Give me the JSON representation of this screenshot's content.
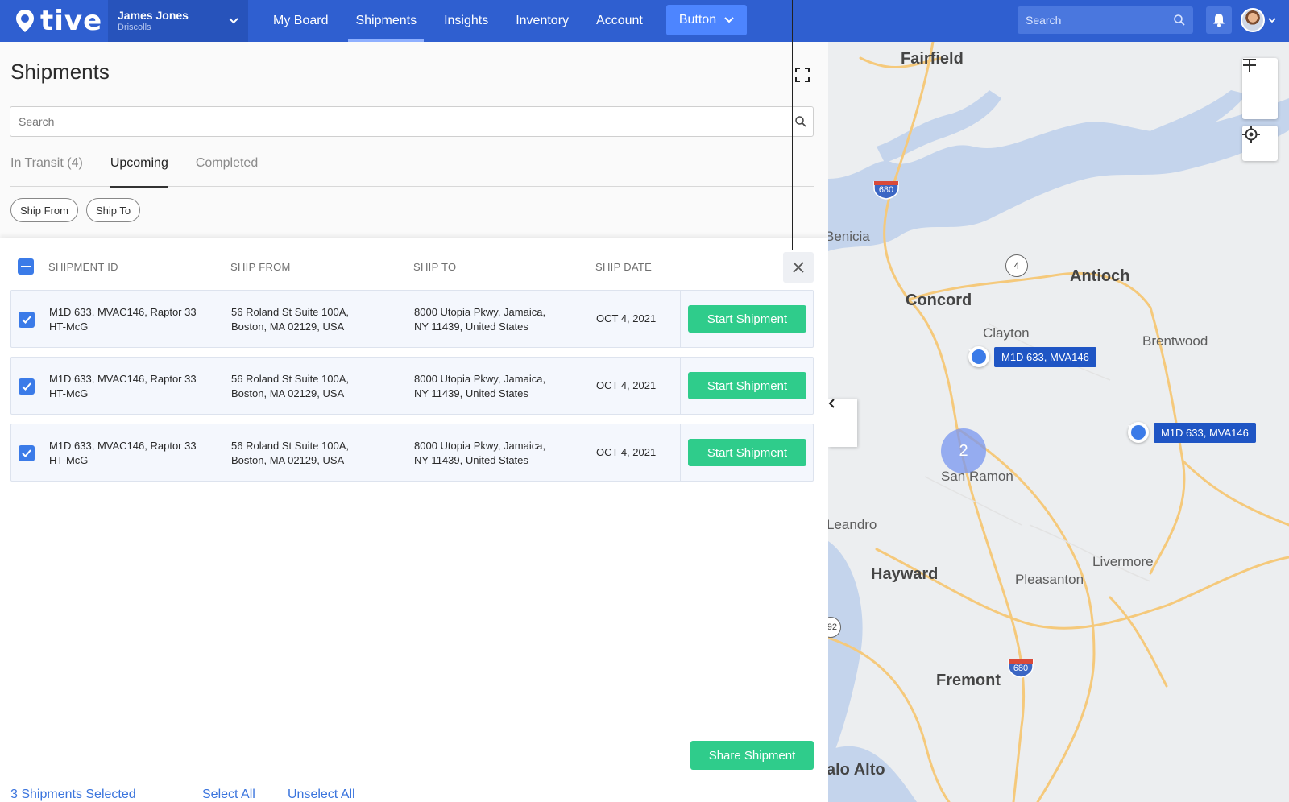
{
  "header": {
    "logo_text": "tive",
    "account_name": "James Jones",
    "account_org": "Driscolls",
    "nav": [
      "My Board",
      "Shipments",
      "Insights",
      "Inventory",
      "Account"
    ],
    "active_nav": "Shipments",
    "button_label": "Button",
    "search_placeholder": "Search"
  },
  "panel": {
    "title": "Shipments",
    "search_placeholder": "Search",
    "tabs": [
      "In Transit (4)",
      "Upcoming",
      "Completed"
    ],
    "active_tab": "Upcoming",
    "chips": [
      "Ship From",
      "Ship To"
    ]
  },
  "table": {
    "columns": [
      "SHIPMENT ID",
      "SHIP FROM",
      "SHIP TO",
      "SHIP DATE"
    ],
    "rows": [
      {
        "id_line1": "M1D 633, MVAC146, Raptor 33",
        "id_line2": "HT-McG",
        "from_line1": "56 Roland St Suite 100A,",
        "from_line2": "Boston, MA 02129, USA",
        "to_line1": "8000 Utopia Pkwy, Jamaica,",
        "to_line2": "NY 11439, United States",
        "date": "OCT 4, 2021",
        "action": "Start Shipment",
        "checked": true
      },
      {
        "id_line1": "M1D 633, MVAC146, Raptor 33",
        "id_line2": "HT-McG",
        "from_line1": "56 Roland St Suite 100A,",
        "from_line2": "Boston, MA 02129, USA",
        "to_line1": "8000 Utopia Pkwy, Jamaica,",
        "to_line2": "NY 11439, United States",
        "date": "OCT 4, 2021",
        "action": "Start Shipment",
        "checked": true
      },
      {
        "id_line1": "M1D 633, MVAC146, Raptor 33",
        "id_line2": "HT-McG",
        "from_line1": "56 Roland St Suite 100A,",
        "from_line2": "Boston, MA 02129, USA",
        "to_line1": "8000 Utopia Pkwy, Jamaica,",
        "to_line2": "NY 11439, United States",
        "date": "OCT 4, 2021",
        "action": "Start Shipment",
        "checked": true
      }
    ]
  },
  "footer": {
    "selected_count": "3 Shipments Selected",
    "select_all": "Select All",
    "unselect_all": "Unselect All",
    "share": "Share Shipment"
  },
  "map": {
    "cities": [
      "Fairfield",
      "Benicia",
      "Concord",
      "Antioch",
      "Clayton",
      "Brentwood",
      "San Ramon",
      "Leandro",
      "Livermore",
      "Hayward",
      "Pleasanton",
      "Fremont",
      "alo Alto"
    ],
    "highway_labels": [
      "680",
      "4",
      "680",
      "92"
    ],
    "pins": [
      "M1D 633, MVA146",
      "M1D 633, MVA146"
    ],
    "cluster_count": "2"
  },
  "colors": {
    "brand": "#2f5fd0",
    "accent_green": "#2fcc8b",
    "link_blue": "#3a74dd"
  }
}
